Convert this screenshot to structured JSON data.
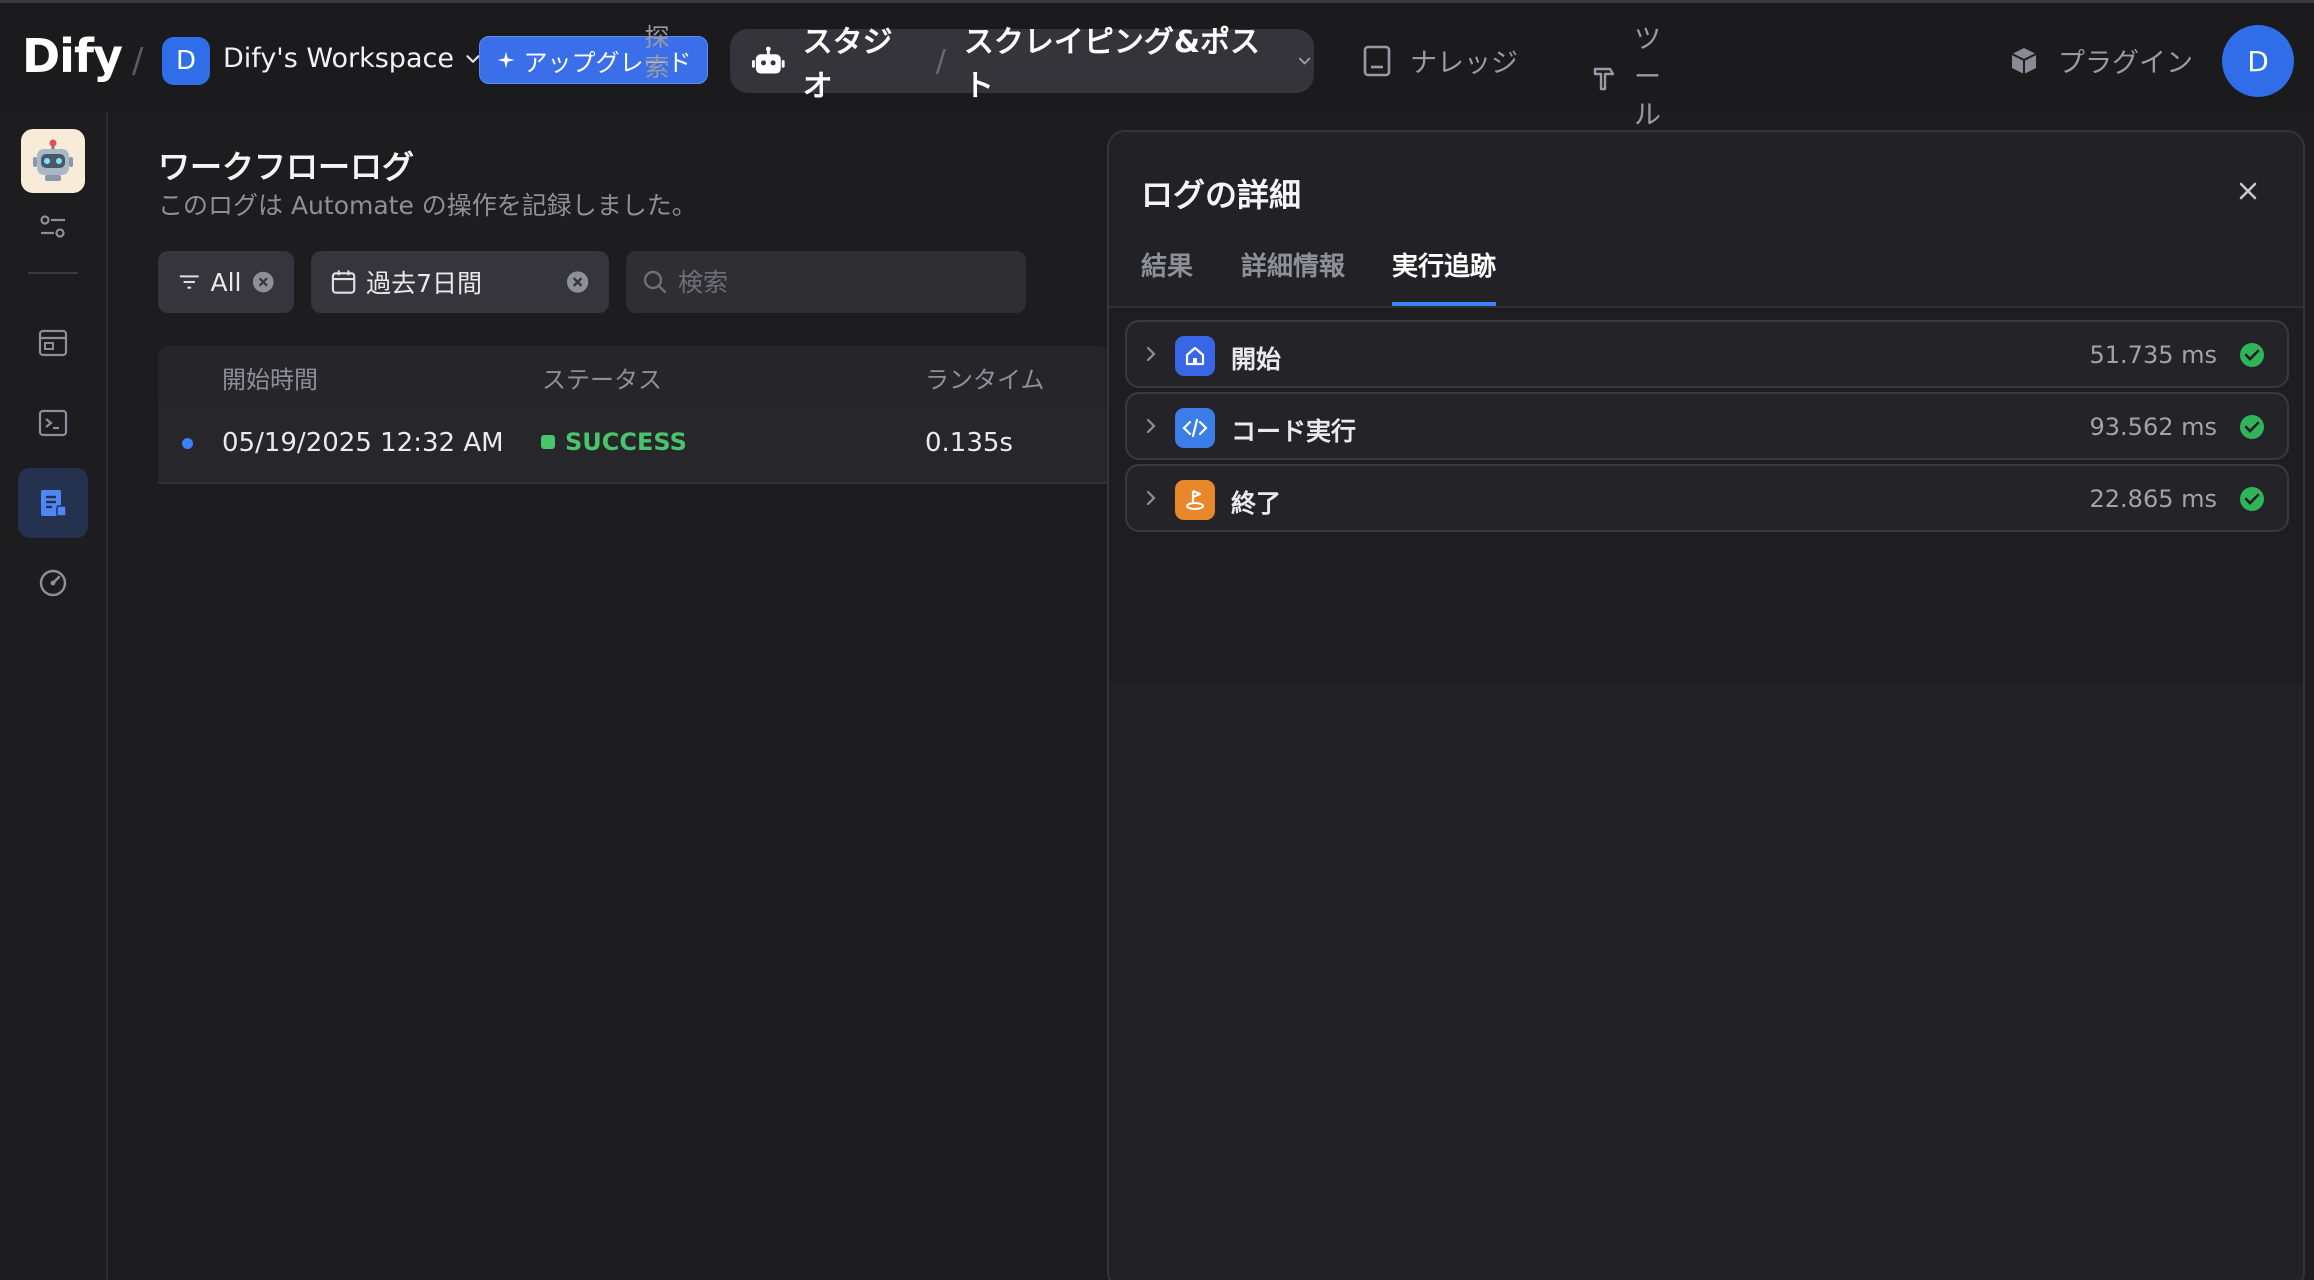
{
  "topbar": {
    "logo": "Dify",
    "workspace_initial": "D",
    "workspace_name": "Dify's Workspace",
    "upgrade_label": "アップグレード",
    "explore_label": "探索",
    "studio_label": "スタジオ",
    "app_name": "スクレイピング&ポスト",
    "knowledge_label": "ナレッジ",
    "tools_label": "ツール",
    "plugins_label": "プラグイン",
    "user_initial": "D"
  },
  "main": {
    "title": "ワークフローログ",
    "subtitle": "このログは Automate の操作を記録しました。",
    "filter_status": "All",
    "filter_period": "過去7日間",
    "search_placeholder": "検索",
    "columns": {
      "start_time": "開始時間",
      "status": "ステータス",
      "runtime": "ランタイム"
    },
    "rows": [
      {
        "start_time": "05/19/2025 12:32 AM",
        "status": "SUCCESS",
        "runtime": "0.135s"
      }
    ]
  },
  "panel": {
    "title": "ログの詳細",
    "tabs": [
      "結果",
      "詳細情報",
      "実行追跡"
    ],
    "active_tab": "実行追跡",
    "nodes": [
      {
        "name": "開始",
        "time": "51.735 ms",
        "icon": "home-icon",
        "color": "#3867e6"
      },
      {
        "name": "コード実行",
        "time": "93.562 ms",
        "icon": "code-icon",
        "color": "#3b7de9"
      },
      {
        "name": "終了",
        "time": "22.865 ms",
        "icon": "flag-icon",
        "color": "#e8882b"
      }
    ]
  },
  "colors": {
    "accent": "#3b82f6",
    "success": "#49c46a",
    "background": "#1d1d20"
  }
}
